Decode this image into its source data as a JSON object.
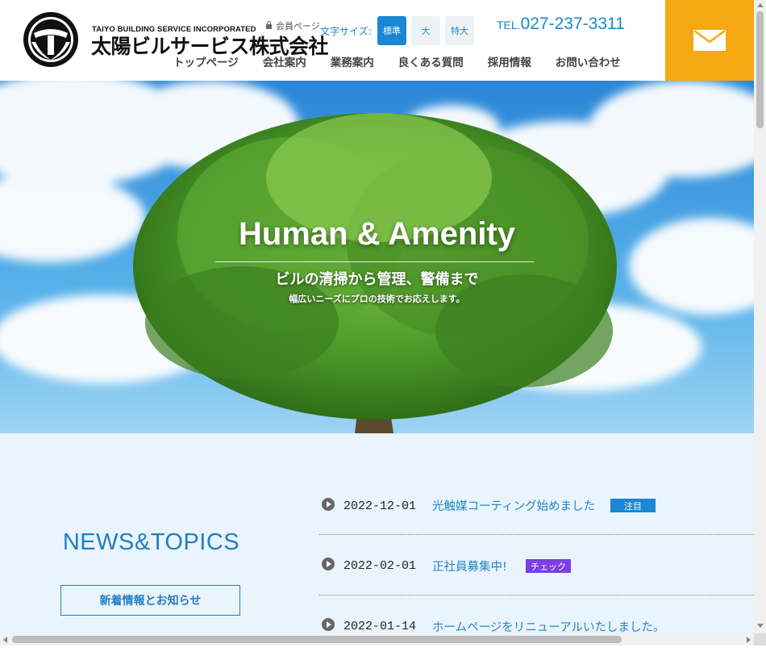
{
  "header": {
    "logo_sub": "TAIYO BUILDING SERVICE INCORPORATED",
    "logo_name": "太陽ビルサービス株式会社",
    "member_link": "会員ページ",
    "font_size_label": "文字サイズ:",
    "font_sizes": [
      "標準",
      "大",
      "特大"
    ],
    "tel_label": "TEL.",
    "tel_number": "027-237-3311",
    "mail_icon": "mail-icon"
  },
  "nav": [
    "トップページ",
    "会社案内",
    "業務案内",
    "良くある質問",
    "採用情報",
    "お問い合わせ"
  ],
  "hero": {
    "title": "Human & Amenity",
    "subtitle": "ビルの清掃から管理、警備まで",
    "tagline": "幅広いニーズにプロの技術でお応えします。"
  },
  "news": {
    "heading": "NEWS&TOPICS",
    "button_label": "新着情報とお知らせ",
    "items": [
      {
        "date": "2022-12-01",
        "title": "光触媒コーティング始めました",
        "badge": "注目",
        "badge_color": "#1a87d2"
      },
      {
        "date": "2022-02-01",
        "title": "正社員募集中!",
        "badge": "チェック",
        "badge_color": "#7b3fe4"
      },
      {
        "date": "2022-01-14",
        "title": "ホームページをリニューアルいたしました。",
        "badge": "",
        "badge_color": ""
      }
    ]
  },
  "colors": {
    "accent_blue": "#1a87d2",
    "mail_orange": "#f6a714",
    "news_bg": "#eaf4fc"
  }
}
